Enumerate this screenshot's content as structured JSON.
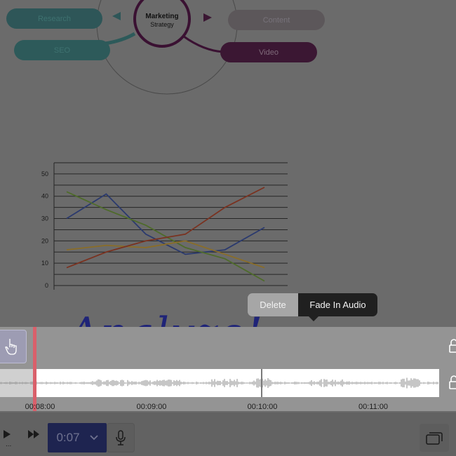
{
  "mindmap": {
    "center_title": "Marketing",
    "center_subtitle": "Strategy",
    "nodes": {
      "research": "Research",
      "seo": "SEO",
      "content": "Content",
      "video": "Video"
    }
  },
  "handwriting": "Analyze!",
  "chart_data": {
    "type": "line",
    "title": "",
    "xlabel": "",
    "ylabel": "",
    "ylim": [
      0,
      55
    ],
    "yticks": [
      0,
      10,
      20,
      30,
      40,
      50
    ],
    "x": [
      1,
      2,
      3,
      4,
      5,
      6
    ],
    "series": [
      {
        "values": [
          30,
          41,
          23,
          14,
          16,
          26
        ],
        "color": "#2b3a6e"
      },
      {
        "values": [
          42,
          34,
          27,
          17,
          12,
          2
        ],
        "color": "#4e6b2a"
      },
      {
        "values": [
          16,
          18,
          17,
          20,
          14,
          8
        ],
        "color": "#8a6d28"
      },
      {
        "values": [
          8,
          15,
          20,
          23,
          35,
          44
        ],
        "color": "#7a3220"
      }
    ]
  },
  "context_menu": {
    "delete": "Delete",
    "fade_in": "Fade In Audio"
  },
  "timeline": {
    "ticks": [
      "00:08:00",
      "00:09:00",
      "00:10:00",
      "00:11:00"
    ]
  },
  "toolbar": {
    "time": "0:07",
    "dots": "..."
  },
  "colors": {
    "research": "#2e5658",
    "seo": "#2d5a5a",
    "content": "#5c575a",
    "video": "#3b1733",
    "mindmap_ring": "#3a1132",
    "playhead": "#d9606b",
    "time_button": "#1e2450"
  },
  "icons": [
    "play-icon",
    "fast-forward-icon",
    "chevron-down-icon",
    "microphone-icon",
    "screens-icon",
    "lock-icon",
    "hand-pointer-icon"
  ]
}
